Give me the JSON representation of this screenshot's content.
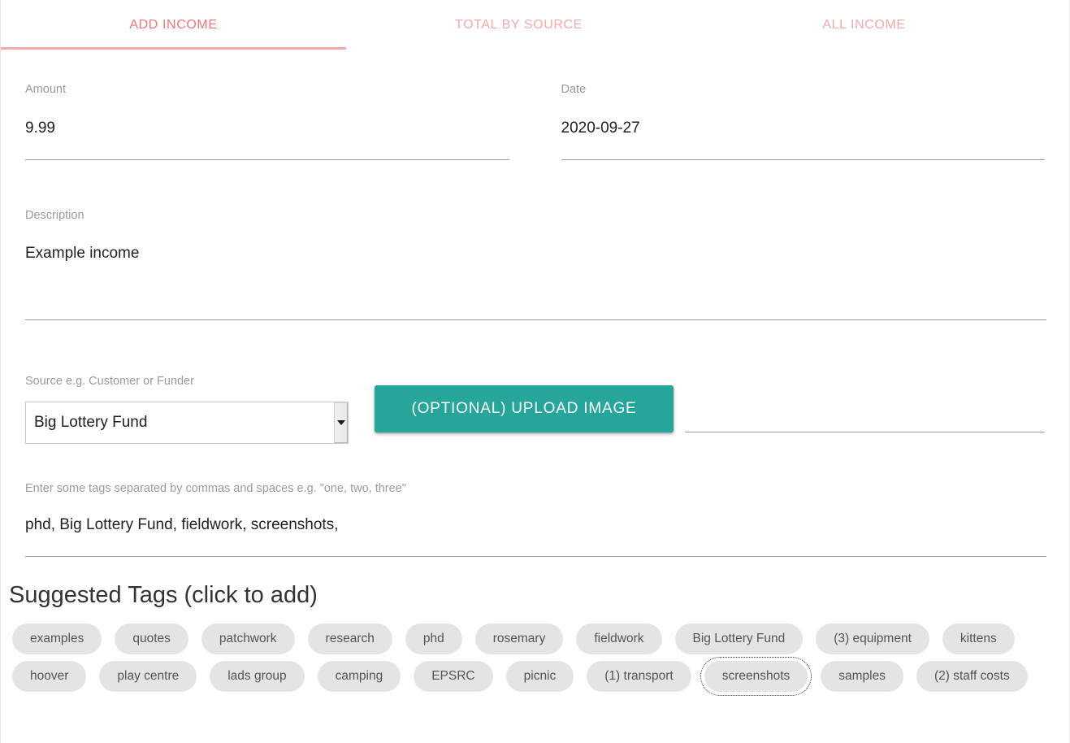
{
  "tabs": [
    {
      "id": "add-income",
      "label": "ADD INCOME",
      "active": true
    },
    {
      "id": "total-by-source",
      "label": "TOTAL BY SOURCE",
      "active": false
    },
    {
      "id": "all-income",
      "label": "ALL INCOME",
      "active": false
    }
  ],
  "form": {
    "amount": {
      "label": "Amount",
      "value": "9.99"
    },
    "date": {
      "label": "Date",
      "value": "2020-09-27"
    },
    "description": {
      "label": "Description",
      "value": "Example income"
    },
    "source": {
      "label": "Source e.g. Customer or Funder",
      "value": "Big Lottery Fund"
    },
    "upload": {
      "label": "(OPTIONAL) UPLOAD IMAGE"
    },
    "file": {
      "value": ""
    },
    "tags": {
      "label": "Enter some tags separated by commas and spaces e.g. \"one, two, three\"",
      "value": "phd, Big Lottery Fund, fieldwork, screenshots,"
    }
  },
  "suggested": {
    "heading": "Suggested Tags (click to add)",
    "rows": [
      [
        {
          "label": "examples",
          "focused": false
        },
        {
          "label": "quotes",
          "focused": false
        },
        {
          "label": "patchwork",
          "focused": false
        },
        {
          "label": "research",
          "focused": false
        },
        {
          "label": "phd",
          "focused": false
        },
        {
          "label": "rosemary",
          "focused": false
        },
        {
          "label": "fieldwork",
          "focused": false
        },
        {
          "label": "Big Lottery Fund",
          "focused": false
        },
        {
          "label": "(3) equipment",
          "focused": false
        },
        {
          "label": "kittens",
          "focused": false
        }
      ],
      [
        {
          "label": "hoover",
          "focused": false
        },
        {
          "label": "play centre",
          "focused": false
        },
        {
          "label": "lads group",
          "focused": false
        },
        {
          "label": "camping",
          "focused": false
        },
        {
          "label": "EPSRC",
          "focused": false
        },
        {
          "label": "picnic",
          "focused": false
        },
        {
          "label": "(1) transport",
          "focused": false
        },
        {
          "label": "screenshots",
          "focused": true
        },
        {
          "label": "samples",
          "focused": false
        },
        {
          "label": "(2) staff costs",
          "focused": false
        }
      ]
    ]
  },
  "colors": {
    "tab_active": "#f2757a",
    "tab_inactive": "#f6aaaa",
    "tab_underline": "#f4a9ab",
    "accent_teal": "#26a69a",
    "chip_bg": "#e4e4e4",
    "label_gray": "#9b9b9b"
  }
}
